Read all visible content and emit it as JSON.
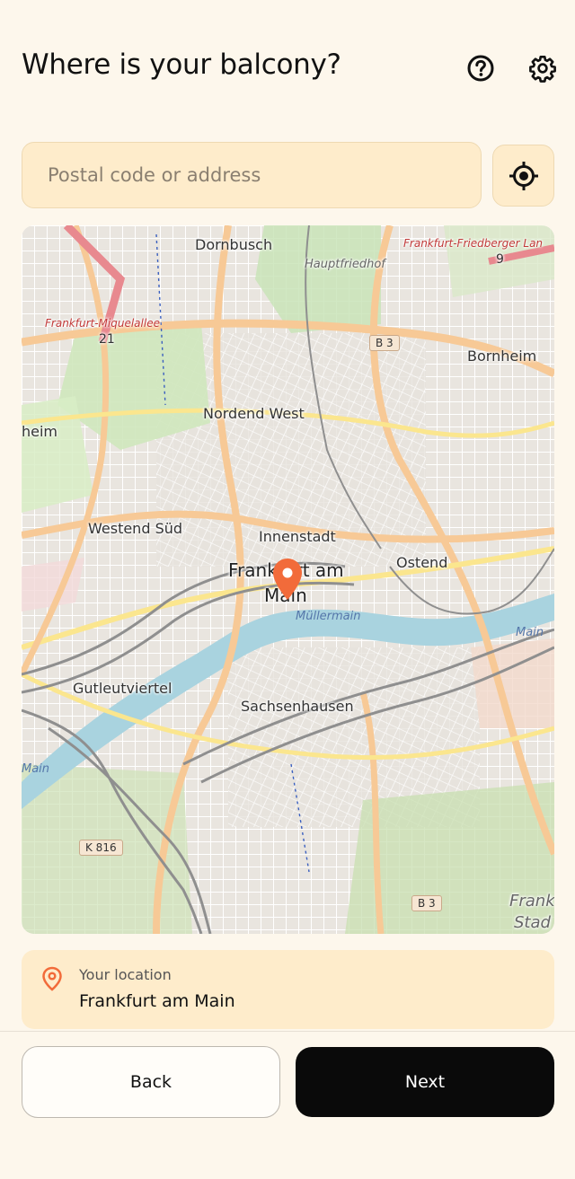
{
  "header": {
    "title": "Where is your balcony?",
    "help_icon": "help-circle-icon",
    "settings_icon": "gear-icon"
  },
  "search": {
    "placeholder": "Postal code or address",
    "value": "",
    "locate_icon": "crosshair-locate-icon"
  },
  "map": {
    "labels": {
      "dornbusch": "Dornbusch",
      "hauptfriedhof": "Hauptfriedhof",
      "frankfurt_friedberger": "Frankfurt-Friedberger Lan",
      "friedberger_num": "9",
      "miquelallee": "Frankfurt-Miquelallee",
      "miquelallee_num": "21",
      "b3_top": "B 3",
      "bornheim": "Bornheim",
      "nordend_west": "Nordend West",
      "heim": "heim",
      "westend_sud": "Westend Süd",
      "innenstadt": "Innenstadt",
      "frankfurt_am_main_line1": "Frankfurt am",
      "frankfurt_am_main_line2": "Main",
      "ostend": "Ostend",
      "mullermain": "Müllermain",
      "main_right": "Main",
      "gutleutviertel": "Gutleutviertel",
      "sachsenhausen": "Sachsenhausen",
      "main_left": "Main",
      "k816": "K 816",
      "b3_bottom": "B 3",
      "frank": "Frank",
      "stad": "Stad"
    },
    "pin_icon": "map-pin-icon",
    "pin_color": "#f26b3a"
  },
  "location": {
    "label": "Your location",
    "value": "Frankfurt am Main",
    "icon": "location-pin-icon",
    "icon_color": "#f26b3a"
  },
  "footer": {
    "back_label": "Back",
    "next_label": "Next"
  }
}
